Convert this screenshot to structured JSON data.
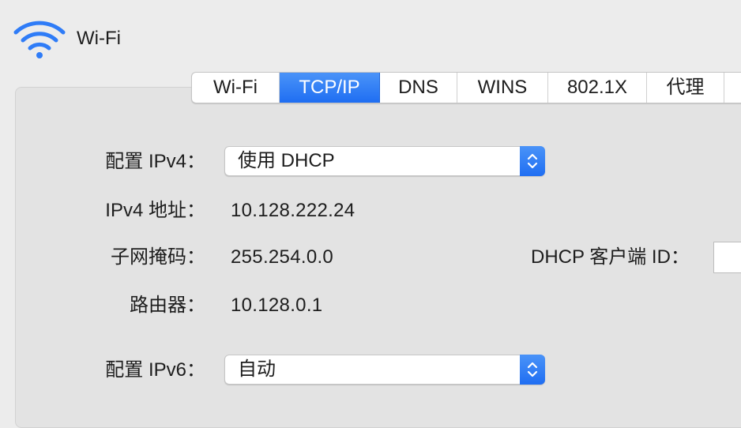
{
  "window": {
    "title": "Wi-Fi",
    "icon": "wifi-icon"
  },
  "tabs": [
    {
      "label": "Wi-Fi",
      "active": false
    },
    {
      "label": "TCP/IP",
      "active": true
    },
    {
      "label": "DNS",
      "active": false
    },
    {
      "label": "WINS",
      "active": false
    },
    {
      "label": "802.1X",
      "active": false
    },
    {
      "label": "代理",
      "active": false
    }
  ],
  "form": {
    "configure_ipv4": {
      "label": "配置 IPv4：",
      "value": "使用 DHCP"
    },
    "ipv4_address": {
      "label": "IPv4 地址：",
      "value": "10.128.222.24"
    },
    "subnet_mask": {
      "label": "子网掩码：",
      "value": "255.254.0.0"
    },
    "router": {
      "label": "路由器：",
      "value": "10.128.0.1"
    },
    "dhcp_client_id": {
      "label": "DHCP 客户端 ID：",
      "value": ""
    },
    "configure_ipv6": {
      "label": "配置 IPv6：",
      "value": "自动"
    }
  },
  "colors": {
    "accent": "#2f7cf7",
    "background": "#ececec",
    "panel": "#e3e3e3"
  }
}
